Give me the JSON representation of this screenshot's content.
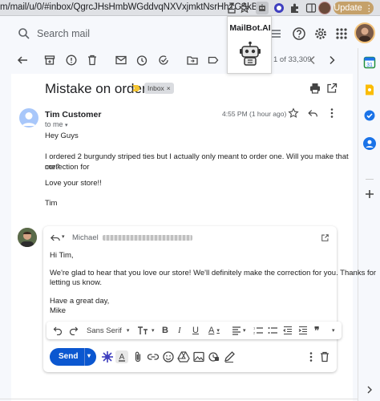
{
  "browser": {
    "url": "m/mail/u/0/#inbox/QgrcJHsHmbWGddvqNXVxjmktNsrHhZCSkBQ",
    "update_label": "Update"
  },
  "header": {
    "search_placeholder": "Search mail"
  },
  "extension_popup": {
    "title": "MailBot.AI",
    "icon": "robot-icon"
  },
  "toolbar": {
    "count": "1 of 33,309"
  },
  "thread": {
    "subject": "Mistake on order",
    "label": "Inbox"
  },
  "message": {
    "sender": "Tim Customer",
    "to": "to me",
    "time": "4:55 PM (1 hour ago)",
    "body": [
      "Hey Guys",
      "I ordered 2 burgundy striped ties but I actually only meant to order one. Will you make that correction for",
      "me?",
      "Love your store!!",
      "Tim"
    ]
  },
  "reply": {
    "from": "Michael",
    "body": [
      "Hi Tim,",
      "We're glad to hear that you love our store! We'll definitely make the correction for you. Thanks for",
      "letting us know.",
      "Have a great day,",
      "Mike"
    ],
    "send_label": "Send",
    "font_name": "Sans Serif"
  },
  "colors": {
    "send_blue": "#0b57d0",
    "update_gold": "#c5a16a"
  }
}
